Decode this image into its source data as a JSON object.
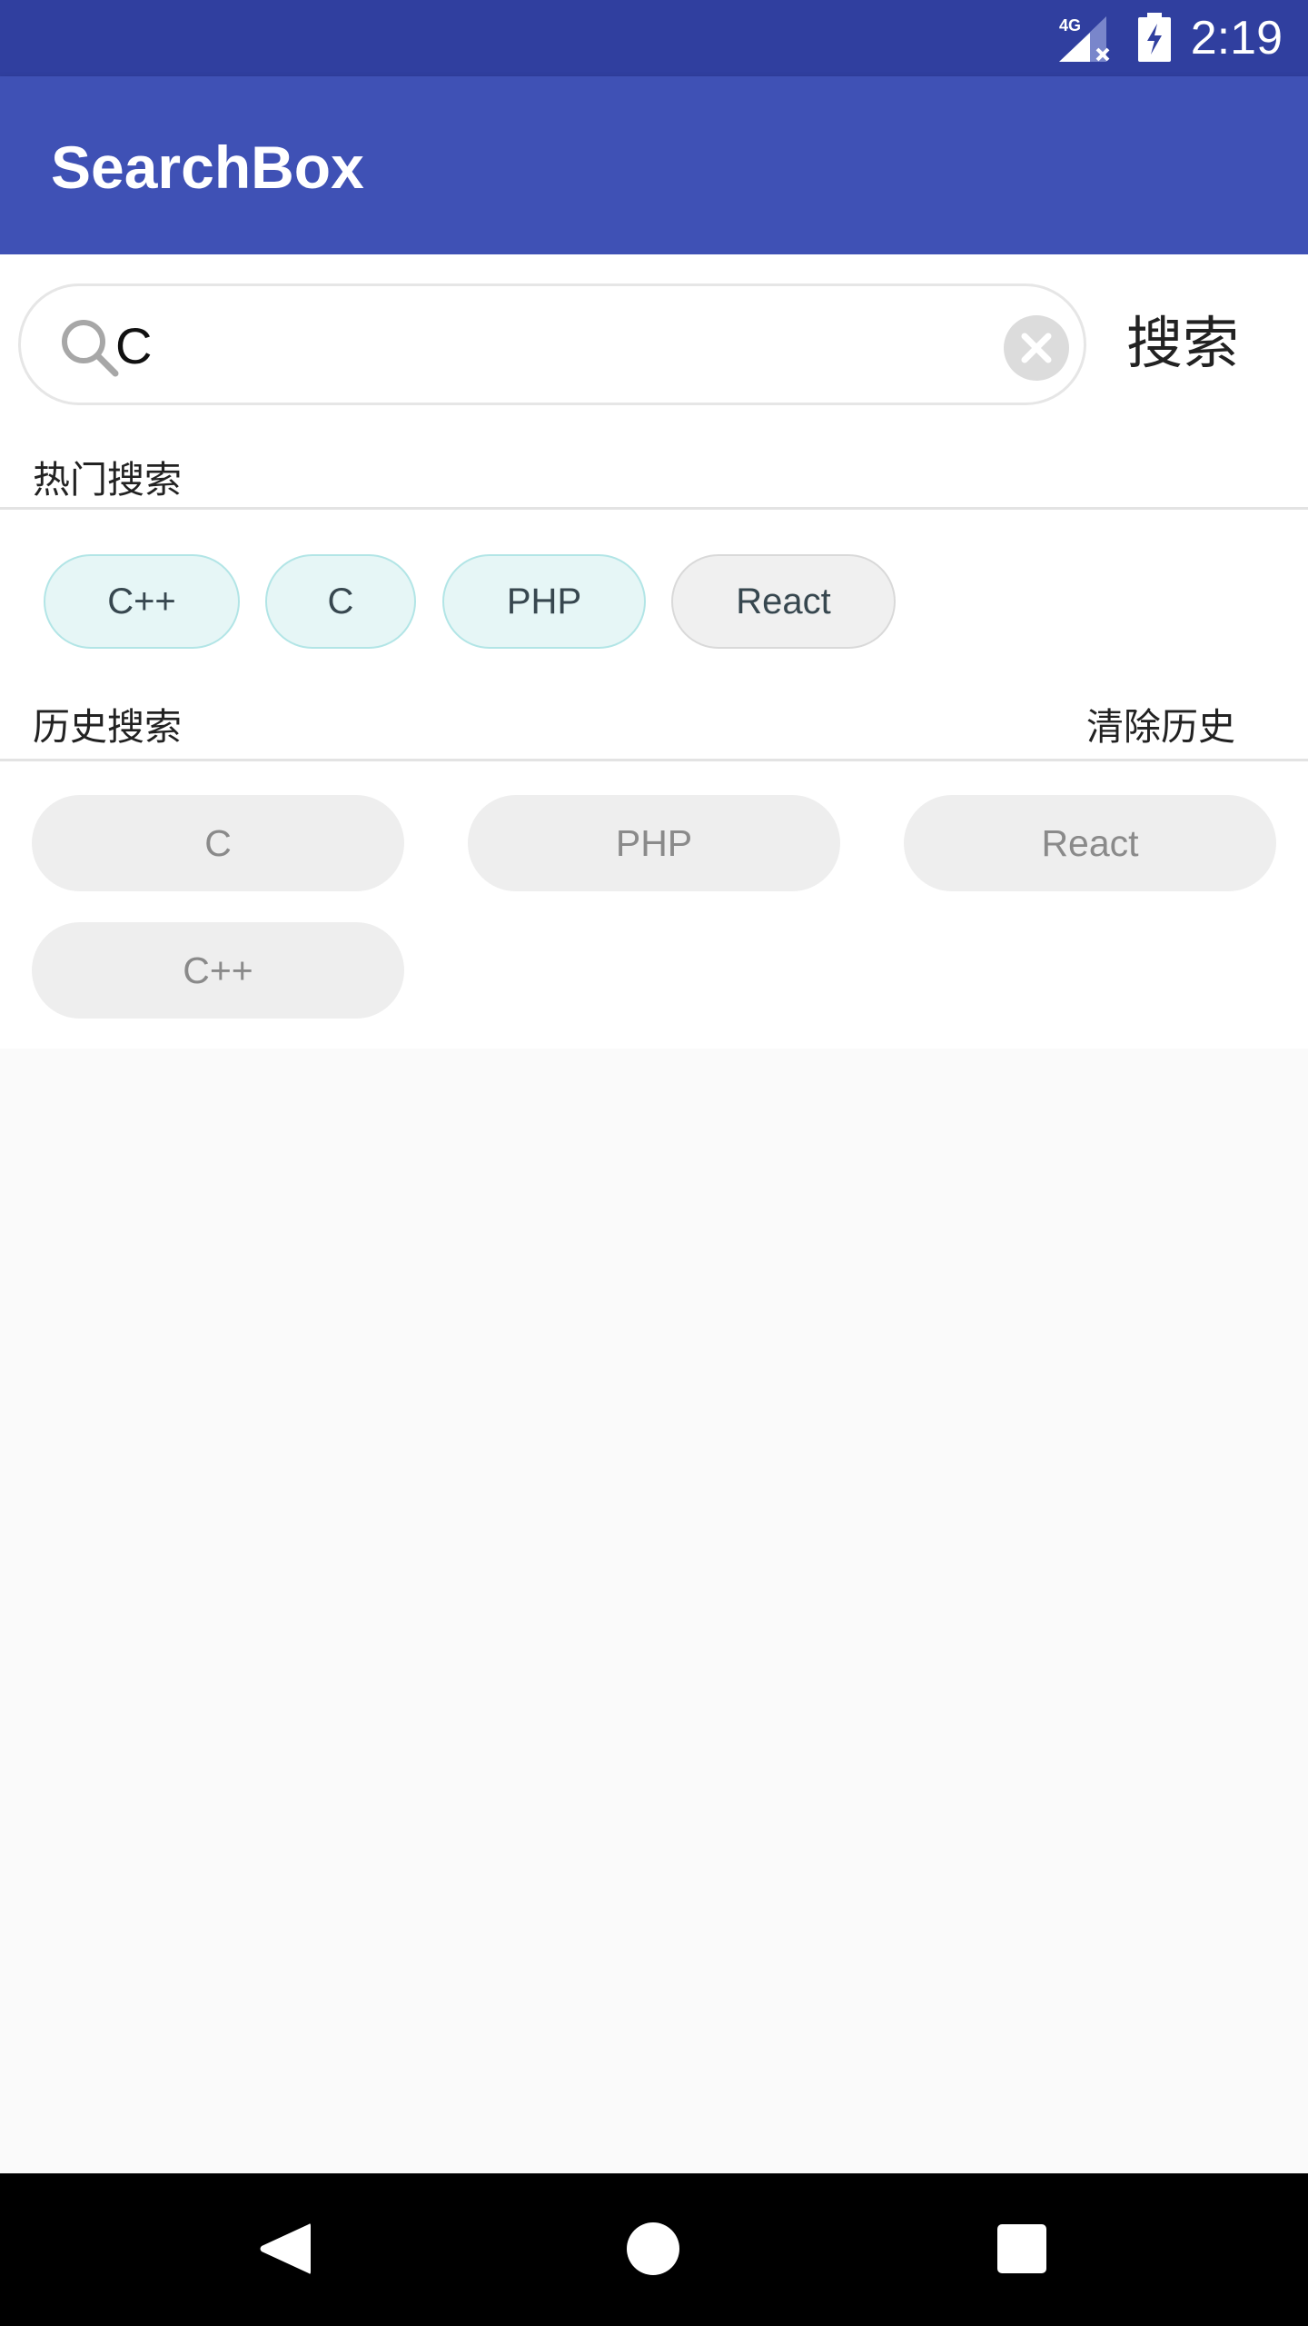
{
  "status_bar": {
    "network": "4G",
    "time": "2:19"
  },
  "app_bar": {
    "title": "SearchBox"
  },
  "search": {
    "value": "C",
    "button_label": "搜索"
  },
  "hot_search": {
    "title": "热门搜索",
    "items": [
      "C++",
      "C",
      "PHP",
      "React"
    ]
  },
  "history_search": {
    "title": "历史搜索",
    "clear_label": "清除历史",
    "items": [
      "C",
      "PHP",
      "React",
      "C++"
    ]
  },
  "colors": {
    "status_bar": "#303f9f",
    "app_bar": "#3f51b5",
    "hot_chip_bg": "#e6f6f6",
    "hot_chip_border": "#b2e5e6",
    "history_chip_bg": "#eeeeee"
  }
}
